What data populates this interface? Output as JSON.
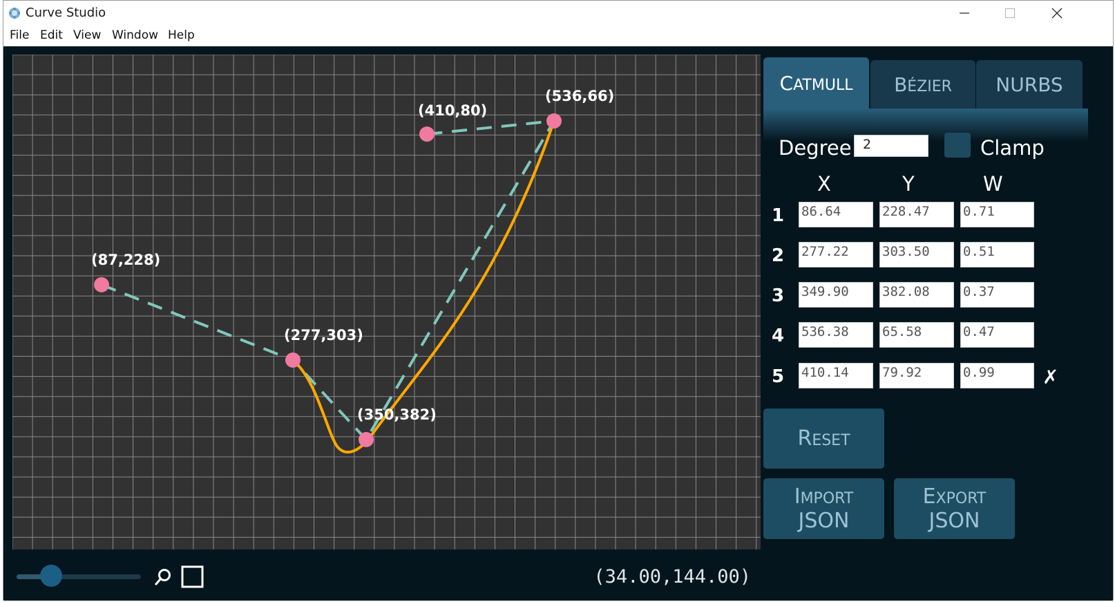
{
  "window": {
    "title": "Curve Studio",
    "app_icon": "gear-flower-icon"
  },
  "menu": [
    "File",
    "Edit",
    "View",
    "Window",
    "Help"
  ],
  "canvas": {
    "points": [
      {
        "label": "(87,228)"
      },
      {
        "label": "(277,303)"
      },
      {
        "label": "(350,382)"
      },
      {
        "label": "(536,66)"
      },
      {
        "label": "(410,80)"
      }
    ],
    "colors": {
      "background": "#333232",
      "grid": "#8a8a8a",
      "point": "#f07aa0",
      "polygon": "#7fc8bd",
      "curve": "#ffa800"
    }
  },
  "zoom": {
    "level": 0.28,
    "icons": [
      "zoom-icon",
      "fit-square-icon"
    ]
  },
  "cursor_readout": "(34.00,144.00)",
  "tabs": [
    {
      "label": "Catmull",
      "active": true
    },
    {
      "label": "Bézier",
      "active": false
    },
    {
      "label": "NURBS",
      "active": false
    }
  ],
  "settings": {
    "degree_label": "Degree",
    "degree_value": "2",
    "clamp_label": "Clamp",
    "clamp_checked": false
  },
  "table": {
    "headers": [
      "X",
      "Y",
      "W"
    ],
    "rows": [
      {
        "index": "1",
        "x": "86.64",
        "y": "228.47",
        "w": "0.71"
      },
      {
        "index": "2",
        "x": "277.22",
        "y": "303.50",
        "w": "0.51"
      },
      {
        "index": "3",
        "x": "349.90",
        "y": "382.08",
        "w": "0.37"
      },
      {
        "index": "4",
        "x": "536.38",
        "y": "65.58",
        "w": "0.47"
      },
      {
        "index": "5",
        "x": "410.14",
        "y": "79.92",
        "w": "0.99"
      }
    ],
    "delete_icon": "✗"
  },
  "buttons": {
    "reset": {
      "first": "R",
      "rest": "ESET"
    },
    "import": {
      "first": "I",
      "rest": "MPORT",
      "line2": "JSON"
    },
    "export": {
      "first": "E",
      "rest": "XPORT",
      "line2": "JSON"
    }
  }
}
